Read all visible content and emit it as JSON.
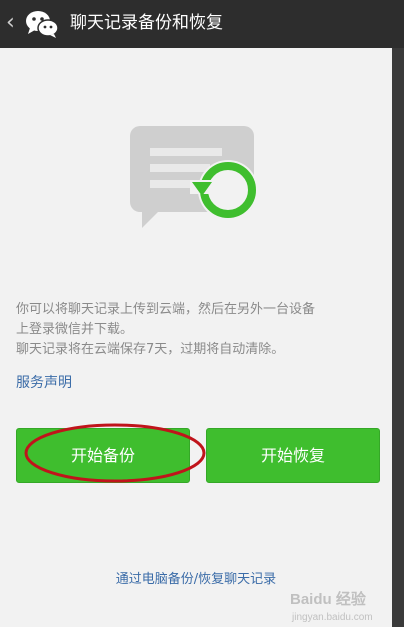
{
  "header": {
    "title": "聊天记录备份和恢复",
    "back_icon": "chevron-left-icon",
    "logo_icon": "wechat-logo-icon"
  },
  "main": {
    "hero_icon": "chat-backup-restore-icon",
    "description_line1": "你可以将聊天记录上传到云端，然后在另外一台设备",
    "description_line2": "上登录微信并下载。",
    "description_line3": "聊天记录将在云端保存7天，过期将自动清除。",
    "service_link": "服务声明",
    "backup_button": "开始备份",
    "restore_button": "开始恢复",
    "pc_link": "通过电脑备份/恢复聊天记录"
  },
  "watermark": {
    "brand": "Baidu 经验",
    "url": "jingyan.baidu.com"
  },
  "colors": {
    "accent_green": "#3fbe2e",
    "link_blue": "#3b6ca8",
    "annotation_red": "#c0141b",
    "topbar": "#2d2d2d",
    "background": "#f2f2f2"
  }
}
